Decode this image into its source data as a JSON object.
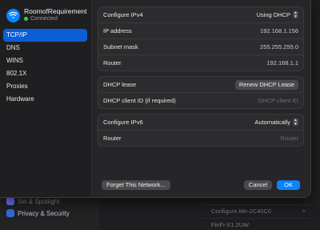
{
  "network": {
    "name": "RoomofRequirement",
    "status": "Connected"
  },
  "sidebar": {
    "items": [
      {
        "label": "TCP/IP",
        "active": true
      },
      {
        "label": "DNS",
        "active": false
      },
      {
        "label": "WINS",
        "active": false
      },
      {
        "label": "802.1X",
        "active": false
      },
      {
        "label": "Proxies",
        "active": false
      },
      {
        "label": "Hardware",
        "active": false
      }
    ]
  },
  "tcpip": {
    "configure_ipv4_label": "Configure IPv4",
    "configure_ipv4_value": "Using DHCP",
    "ip_address_label": "IP address",
    "ip_address_value": "192.168.1.156",
    "subnet_mask_label": "Subnet mask",
    "subnet_mask_value": "255.255.255.0",
    "router_label": "Router",
    "router_value": "192.168.1.1",
    "dhcp_lease_label": "DHCP lease",
    "renew_button": "Renew DHCP Lease",
    "dhcp_client_id_label": "DHCP client ID (if required)",
    "dhcp_client_id_placeholder": "DHCP client ID",
    "configure_ipv6_label": "Configure IPv6",
    "configure_ipv6_value": "Automatically",
    "router6_label": "Router",
    "router6_value": "Router"
  },
  "footer": {
    "forget_button": "Forget This Network...",
    "cancel_button": "Cancel",
    "ok_button": "OK"
  },
  "background": {
    "sidebar_items": [
      "Siri & Spotlight",
      "Privacy & Security"
    ],
    "network_rows": [
      "Configure.Me-2C40C0",
      "FinFi-X1.2UW"
    ]
  },
  "colors": {
    "accent": "#0a84ff",
    "selection": "#0a5fd6",
    "connected": "#30d158"
  }
}
